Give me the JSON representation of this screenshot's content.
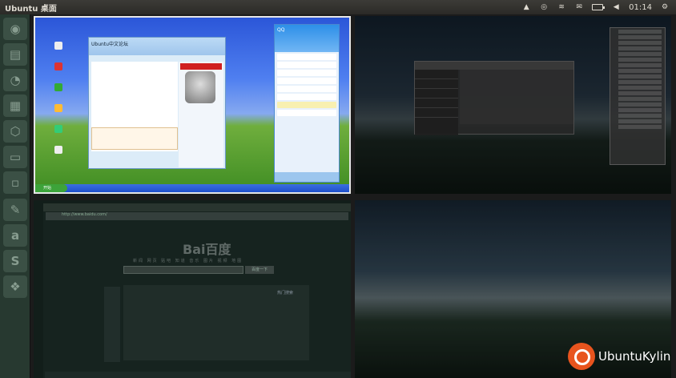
{
  "topbar": {
    "title": "Ubuntu 桌面",
    "clock": "01:14",
    "indicators": [
      "keyboard-icon",
      "qq-tray-icon",
      "wifi-icon",
      "mail-icon",
      "battery-icon",
      "volume-icon"
    ]
  },
  "launcher": {
    "items": [
      {
        "name": "dash-icon",
        "glyph": "◉"
      },
      {
        "name": "files-icon",
        "glyph": "▤"
      },
      {
        "name": "firefox-icon",
        "glyph": "◔"
      },
      {
        "name": "office-icon",
        "glyph": "▦"
      },
      {
        "name": "software-center-icon",
        "glyph": "⬡"
      },
      {
        "name": "system-settings-icon",
        "glyph": "▭"
      },
      {
        "name": "terminal-icon",
        "glyph": "▫"
      },
      {
        "name": "text-editor-icon",
        "glyph": "✎"
      },
      {
        "name": "account-icon",
        "glyph": "a"
      },
      {
        "name": "sogou-icon",
        "glyph": "S"
      },
      {
        "name": "workspace-switcher-icon",
        "glyph": "❖"
      }
    ]
  },
  "workspace1": {
    "chat_title": "Ubuntu中文论坛",
    "qq_window_title": "QQ",
    "start_label": "开始"
  },
  "workspace3": {
    "url": "http://www.baidu.com/",
    "baidu_logo": "Bai百度",
    "search_button": "百度一下",
    "nav": "新闻 网页 贴吧 知道 音乐 图片 视频 地图",
    "card_title": "热门搜索"
  },
  "brand": {
    "text": "UbuntuKylin",
    "color": "#e8541e"
  }
}
